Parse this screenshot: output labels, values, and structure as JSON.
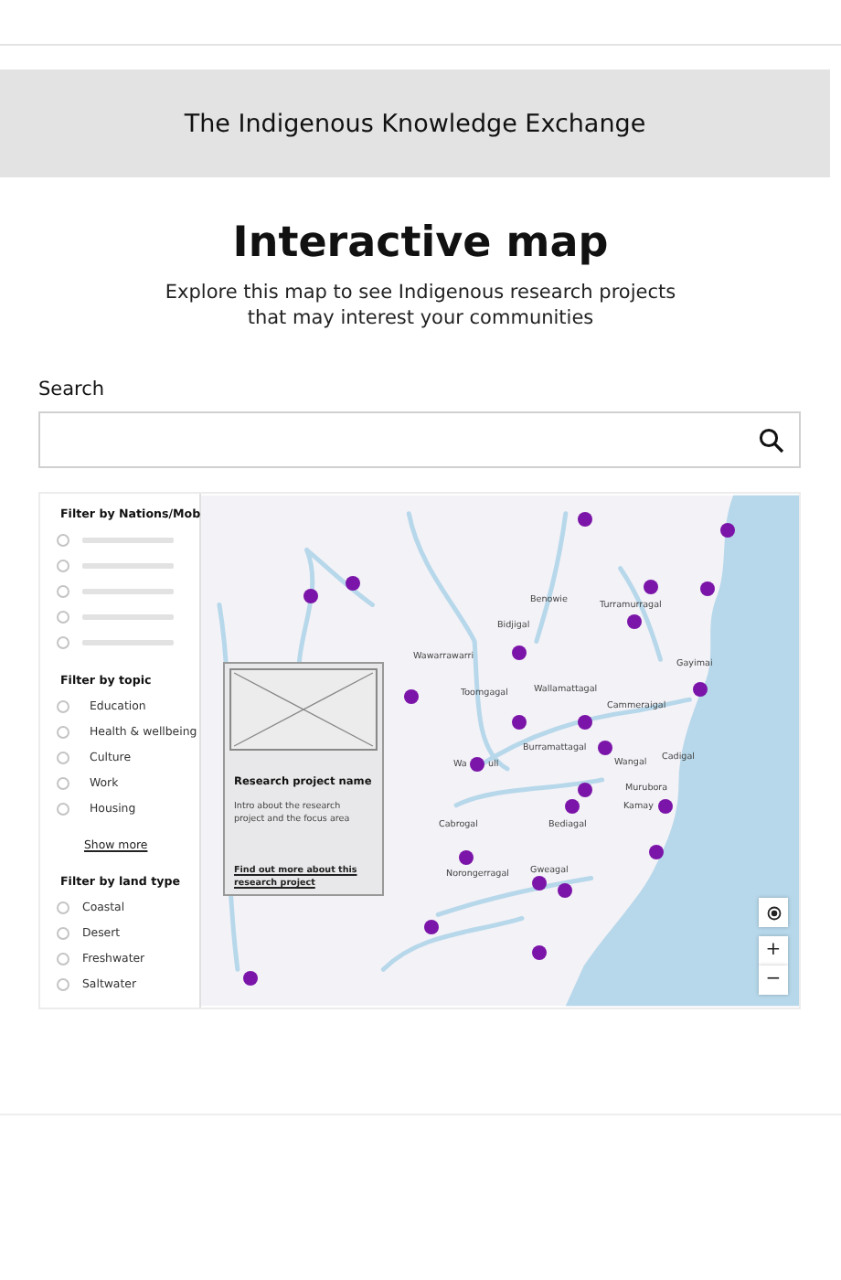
{
  "header": {
    "title": "The Indigenous Knowledge Exchange"
  },
  "page": {
    "heading": "Interactive map",
    "intro": "Explore this map to see Indigenous research projects that may interest your communities"
  },
  "search": {
    "label": "Search"
  },
  "filters": [
    {
      "title": "Filter by Nations/Mob",
      "options": [
        {
          "checked": false
        },
        {
          "checked": false
        },
        {
          "checked": false
        },
        {
          "checked": false
        },
        {
          "checked": false
        }
      ]
    },
    {
      "title": "Filter by topic",
      "options": [
        {
          "label": "Education",
          "checked": false
        },
        {
          "label": "Health & wellbeing",
          "checked": false
        },
        {
          "label": "Culture",
          "checked": false
        },
        {
          "label": "Work",
          "checked": false
        },
        {
          "label": "Housing",
          "checked": false
        }
      ],
      "more": "Show more"
    },
    {
      "title": "Filter by land type",
      "options": [
        {
          "label": "Coastal",
          "checked": false
        },
        {
          "label": "Desert",
          "checked": false
        },
        {
          "label": "Freshwater",
          "checked": false
        },
        {
          "label": "Saltwater",
          "checked": false
        }
      ]
    }
  ],
  "map": {
    "labels": [
      "Benowie",
      "Turramurragal",
      "Bidjigal",
      "Wawarrawarri",
      "Gayimai",
      "Toomgagal",
      "Wallamattagal",
      "Cammeraigal",
      "Burramattagal",
      "Wangal",
      "Cadigal",
      "Wa",
      "ull",
      "Murubora",
      "Kamay",
      "Cabrogal",
      "Bediagal",
      "Norongerragal",
      "Gweagal"
    ],
    "popup": {
      "title": "Research project name",
      "text": "Intro about the research project and the focus area",
      "link": "Find out more about this research project"
    },
    "controls": [
      "+",
      "−"
    ]
  }
}
